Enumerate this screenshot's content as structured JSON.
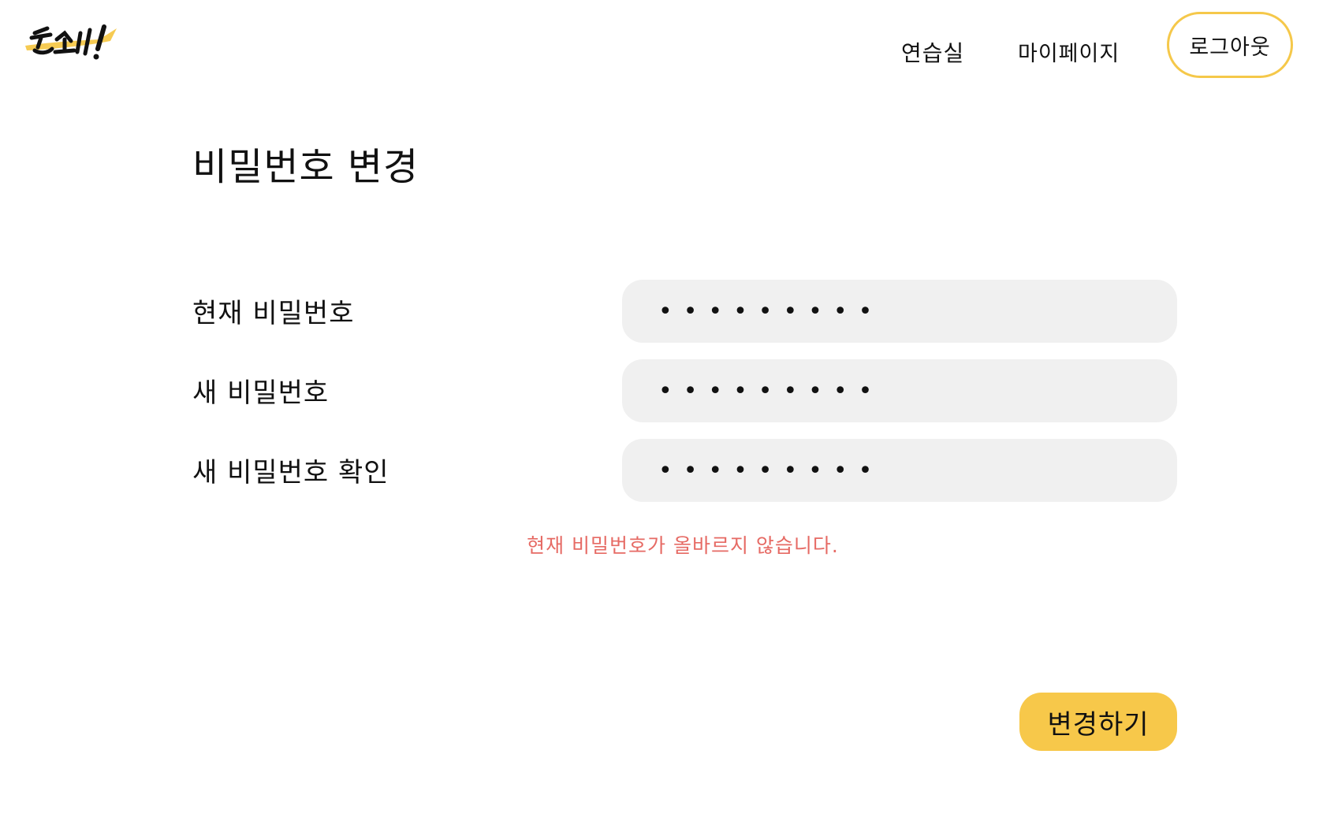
{
  "header": {
    "logo_text": "쓴소리!",
    "nav_practice": "연습실",
    "nav_mypage": "마이페이지",
    "logout": "로그아웃"
  },
  "page_title": "비밀번호 변경",
  "form": {
    "current_password_label": "현재 비밀번호",
    "current_password_value": "•••••••••",
    "new_password_label": "새 비밀번호",
    "new_password_value": "•••••••••",
    "confirm_password_label": "새 비밀번호 확인",
    "confirm_password_value": "•••••••••",
    "error_message": "현재 비밀번호가 올바르지 않습니다.",
    "submit_label": "변경하기"
  },
  "colors": {
    "accent": "#f7c84a",
    "input_bg": "#f0f0f0",
    "error": "#e66a64",
    "text": "#111111"
  }
}
